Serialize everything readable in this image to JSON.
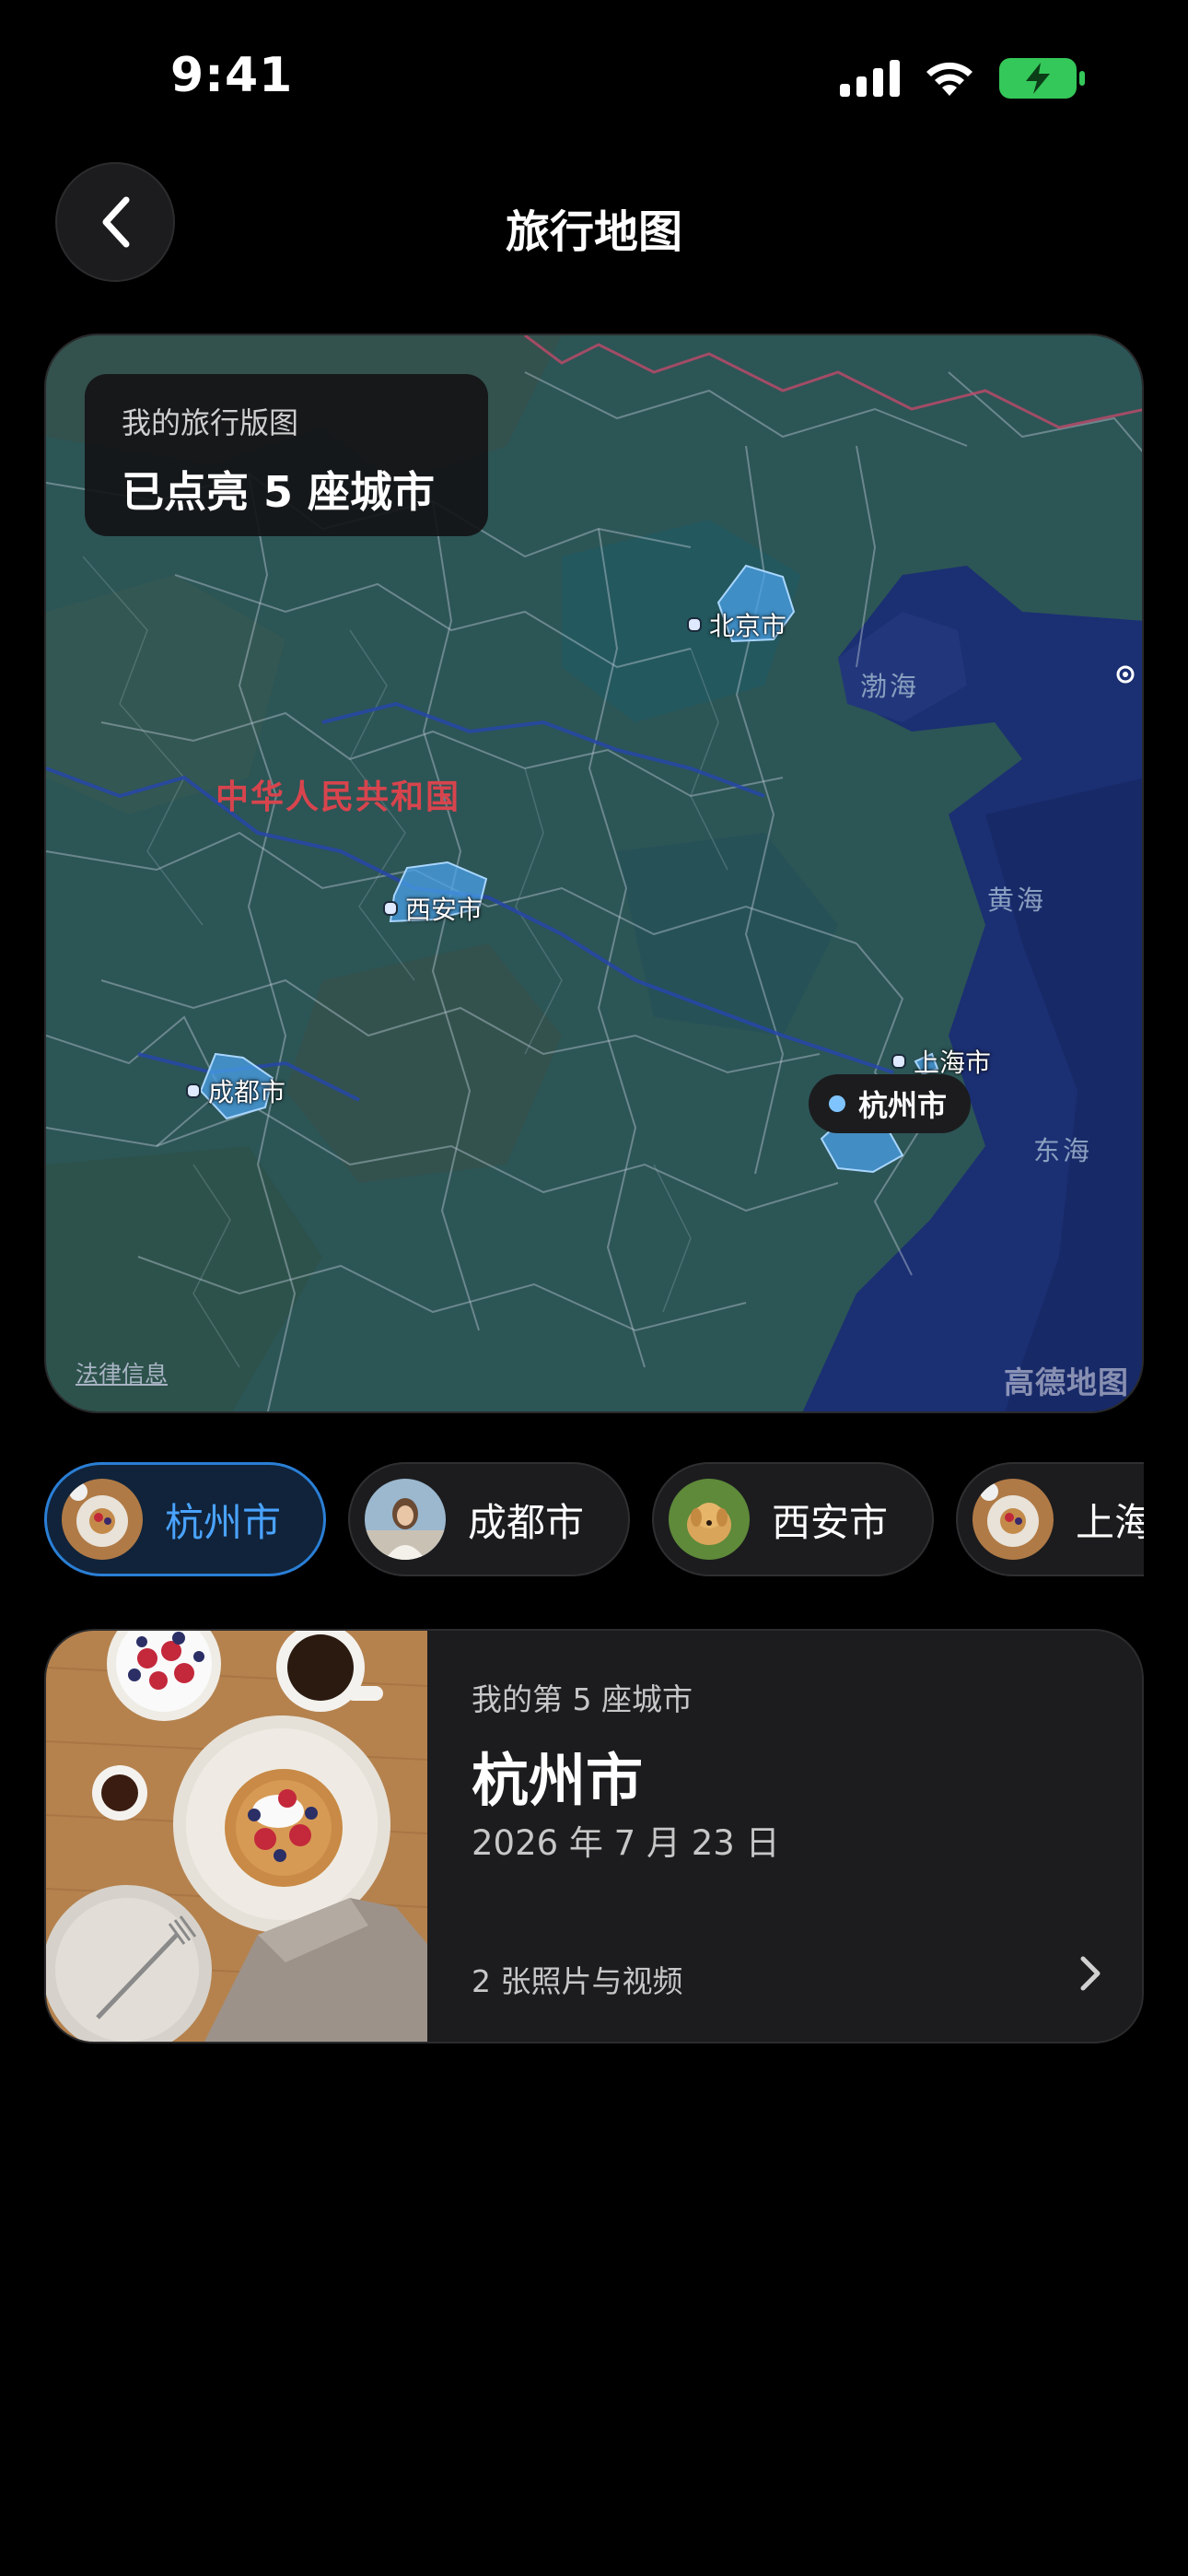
{
  "status_bar": {
    "time": "9:41"
  },
  "header": {
    "title": "旅行地图"
  },
  "map": {
    "summary_subtitle": "我的旅行版图",
    "summary_title": "已点亮 5 座城市",
    "country_label": "中华人民共和国",
    "cities": [
      {
        "name": "北京市"
      },
      {
        "name": "西安市"
      },
      {
        "name": "成都市"
      },
      {
        "name": "上海市"
      }
    ],
    "selected_city": "杭州市",
    "seas": [
      "渤海",
      "黄海",
      "东海"
    ],
    "legal_link": "法律信息",
    "provider": "高德地图"
  },
  "chips": [
    {
      "label": "杭州市",
      "active": true
    },
    {
      "label": "成都市",
      "active": false
    },
    {
      "label": "西安市",
      "active": false
    },
    {
      "label": "上海市",
      "active": false
    }
  ],
  "detail": {
    "subtitle": "我的第 5 座城市",
    "title": "杭州市",
    "date": "2026 年 7 月 23 日",
    "media_count": "2 张照片与视频"
  },
  "colors": {
    "accent": "#4aa3ff",
    "background": "#000000",
    "card": "#1c1c1e",
    "battery": "#34c759"
  }
}
